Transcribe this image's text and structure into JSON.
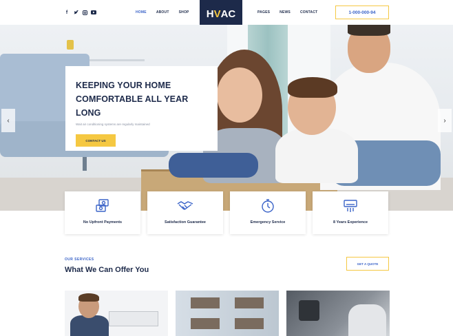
{
  "header": {
    "social": [
      "f",
      "t",
      "ig",
      "yt"
    ],
    "nav_left": [
      {
        "label": "HOME",
        "active": true
      },
      {
        "label": "ABOUT",
        "active": false
      },
      {
        "label": "SHOP",
        "active": false
      }
    ],
    "logo": {
      "prefix": "H",
      "accent": "V",
      "suffix": "AC"
    },
    "nav_right": [
      {
        "label": "PAGES"
      },
      {
        "label": "NEWS"
      },
      {
        "label": "CONTACT"
      }
    ],
    "phone": "1-000-000-94"
  },
  "hero": {
    "title_line1": "KEEPING YOUR HOME",
    "title_line2": "COMFORTABLE ALL YEAR LONG",
    "subtitle": "Wait air conditioning systems are regularly maintained",
    "button": "CONTACT US",
    "prev_arrow": "‹",
    "next_arrow": "›"
  },
  "features": [
    {
      "label": "No Upfront Payments",
      "icon": "cash-icon"
    },
    {
      "label": "Satisfaction Guarantee",
      "icon": "handshake-icon"
    },
    {
      "label": "Emergency Service",
      "icon": "stopwatch-icon"
    },
    {
      "label": "8 Years Experience",
      "icon": "ac-unit-icon"
    }
  ],
  "services": {
    "eyebrow": "OUR SERVICES",
    "title": "What We Can Offer You",
    "button": "GET A QUOTE"
  },
  "colors": {
    "navy": "#1d2a4a",
    "accent_blue": "#3a63c8",
    "yellow": "#f5c842"
  }
}
